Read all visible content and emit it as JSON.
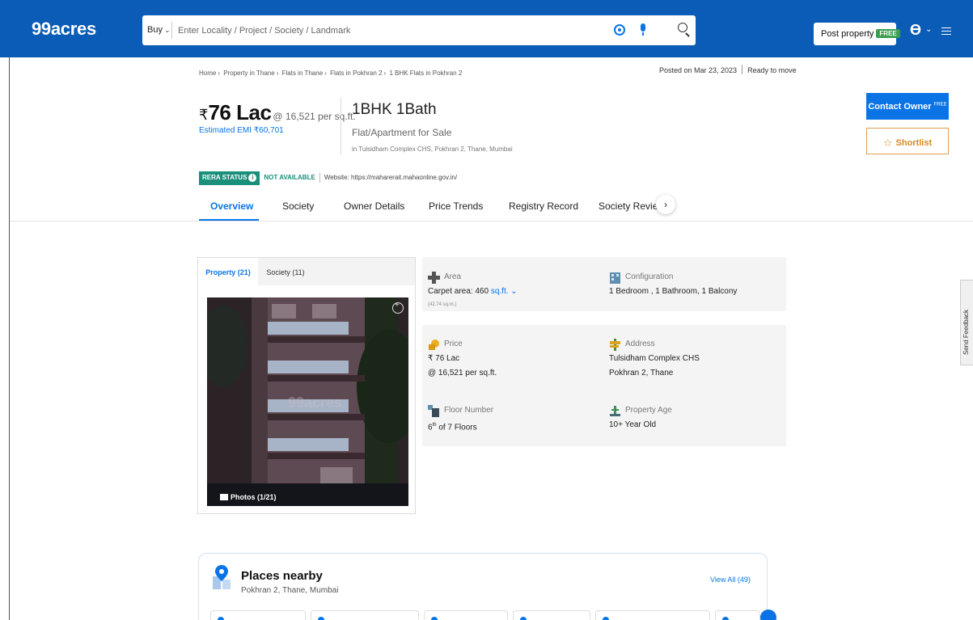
{
  "header": {
    "logo": "99acres",
    "search": {
      "type_label": "Buy",
      "placeholder": "Enter Locality / Project / Society / Landmark"
    },
    "post_property_label": "Post property",
    "post_property_badge": "FREE"
  },
  "breadcrumb": [
    "Home",
    "Property in Thane",
    "Flats in Thane",
    "Flats in Pokhran 2",
    "1 BHK Flats in Pokhran 2"
  ],
  "listing": {
    "posted_on": "Posted on Mar 23, 2023",
    "possession": "Ready to move",
    "price_symbol": "₹",
    "price": "76 Lac",
    "price_per_sqft": "@ 16,521 per sq.ft.",
    "emi": "Estimated EMI ₹60,701",
    "config": "1BHK 1Bath",
    "type": "Flat/Apartment for Sale",
    "location": "in Tulsidham Complex CHS, Pokhran 2, Thane, Mumbai"
  },
  "actions": {
    "contact_owner": "Contact Owner",
    "contact_badge": "FREE",
    "shortlist": "Shortlist"
  },
  "rera": {
    "label": "RERA STATUS",
    "status": "NOT AVAILABLE",
    "website": "Website: https://maharerait.mahaonline.gov.in/"
  },
  "tabs": [
    "Overview",
    "Society",
    "Owner Details",
    "Price Trends",
    "Registry Record",
    "Society Reviews"
  ],
  "gallery": {
    "tabs": [
      "Property (21)",
      "Society (11)"
    ],
    "photos_label": "Photos (1/21)"
  },
  "details": {
    "area": {
      "label": "Area",
      "value": "Carpet area: 460",
      "unit": "sq.ft.",
      "sub": "(42.74 sq.m.)"
    },
    "configuration": {
      "label": "Configuration",
      "value": "1 Bedroom , 1 Bathroom, 1 Balcony"
    },
    "price": {
      "label": "Price",
      "value": "₹ 76 Lac",
      "value2": "@ 16,521 per sq.ft."
    },
    "address": {
      "label": "Address",
      "value": "Tulsidham Complex CHS",
      "value2": "Pokhran 2, Thane"
    },
    "floor": {
      "label": "Floor Number",
      "value_num": "6",
      "value_sup": "th",
      "value_rest": " of 7 Floors"
    },
    "age": {
      "label": "Property Age",
      "value": "10+ Year Old"
    }
  },
  "feedback": "Send Feedback",
  "places": {
    "title": "Places nearby",
    "subtitle": "Pokhran 2, Thane, Mumbai",
    "view_all": "View All (49)"
  },
  "colors": {
    "brand": "#0a5cb6",
    "accent": "#0a74e6",
    "rera": "#1a8f7a",
    "shortlist": "#d98a1a"
  }
}
